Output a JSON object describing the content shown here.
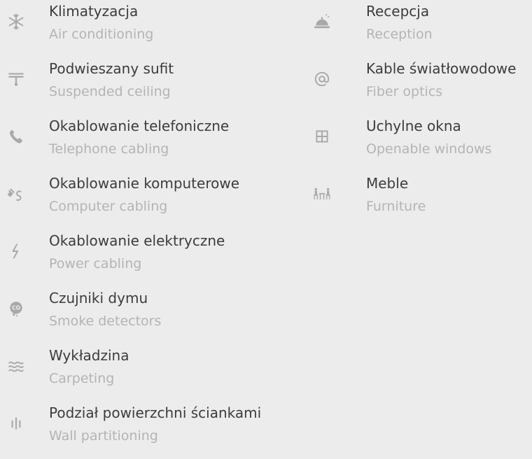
{
  "left": [
    {
      "icon": "snowflake-icon",
      "pl": "Klimatyzacja",
      "en": "Air conditioning"
    },
    {
      "icon": "ceiling-lamp-icon",
      "pl": "Podwieszany sufit",
      "en": "Suspended ceiling"
    },
    {
      "icon": "phone-icon",
      "pl": "Okablowanie telefoniczne",
      "en": "Telephone cabling"
    },
    {
      "icon": "cable-plug-icon",
      "pl": "Okablowanie komputerowe",
      "en": "Computer cabling"
    },
    {
      "icon": "lightning-icon",
      "pl": "Okablowanie elektryczne",
      "en": "Power cabling"
    },
    {
      "icon": "co-smoke-icon",
      "pl": "Czujniki dymu",
      "en": "Smoke detectors"
    },
    {
      "icon": "waves-icon",
      "pl": "Wykładzina",
      "en": "Carpeting"
    },
    {
      "icon": "partition-icon",
      "pl": "Podział powierzchni ściankami",
      "en": "Wall partitioning"
    }
  ],
  "right": [
    {
      "icon": "reception-bell-icon",
      "pl": "Recepcja",
      "en": "Reception"
    },
    {
      "icon": "at-sign-icon",
      "pl": "Kable światłowodowe",
      "en": "Fiber optics"
    },
    {
      "icon": "window-icon",
      "pl": "Uchylne okna",
      "en": "Openable windows"
    },
    {
      "icon": "furniture-icon",
      "pl": "Meble",
      "en": "Furniture"
    }
  ]
}
